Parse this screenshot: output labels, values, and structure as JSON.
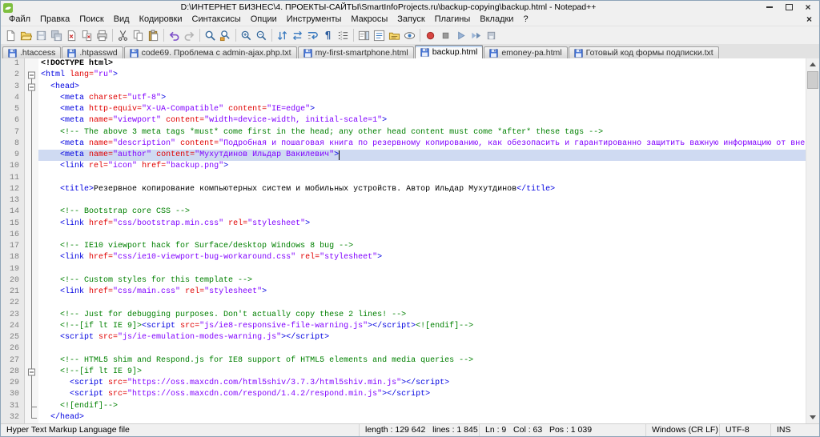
{
  "window": {
    "title": "D:\\ИНТЕРНЕТ БИЗНЕС\\4. ПРОЕКТЫ-САЙТЫ\\SmartInfoProjects.ru\\backup-copying\\backup.html - Notepad++",
    "icons": {
      "close": "×",
      "app": "notepad-plus-plus-logo"
    }
  },
  "menubar": {
    "items": [
      "Файл",
      "Правка",
      "Поиск",
      "Вид",
      "Кодировки",
      "Синтаксисы",
      "Опции",
      "Инструменты",
      "Макросы",
      "Запуск",
      "Плагины",
      "Вкладки",
      "?"
    ],
    "close_glyph": "×"
  },
  "toolbar": {
    "icons": [
      "new",
      "open",
      "save",
      "save-all",
      "close",
      "close-all",
      "print",
      "|",
      "cut",
      "copy",
      "paste",
      "|",
      "undo",
      "redo",
      "|",
      "find",
      "replace",
      "|",
      "zoom-in",
      "zoom-out",
      "|",
      "sync-v",
      "sync-h",
      "wrap",
      "show-all-chars",
      "indent-guide",
      "|",
      "doc-map",
      "function-list",
      "folder-workspace",
      "monitoring",
      "|",
      "record-macro",
      "stop-macro",
      "play-macro",
      "play-multi",
      "save-macro"
    ]
  },
  "tabs": [
    {
      "label": ".htaccess",
      "active": false
    },
    {
      "label": ".htpasswd",
      "active": false
    },
    {
      "label": "code69. Проблема с admin-ajax.php.txt",
      "active": false
    },
    {
      "label": "my-first-smartphone.html",
      "active": false
    },
    {
      "label": "backup.html",
      "active": true
    },
    {
      "label": "emoney-pa.html",
      "active": false
    },
    {
      "label": "Готовый код формы подписки.txt",
      "active": false
    }
  ],
  "editor": {
    "current_line": 9,
    "caret": {
      "line": 9,
      "col": 63
    },
    "lines": [
      {
        "f": "none",
        "s": [
          [
            "d",
            "<!DOCTYPE html>"
          ]
        ]
      },
      {
        "f": "start",
        "s": [
          [
            "t",
            "<html "
          ],
          [
            "a",
            "lang="
          ],
          [
            "v",
            "\"ru\""
          ],
          [
            "t",
            ">"
          ]
        ]
      },
      {
        "f": "start2",
        "s": [
          [
            "x",
            "  "
          ],
          [
            "t",
            "<head>"
          ]
        ]
      },
      {
        "f": "line",
        "s": [
          [
            "x",
            "    "
          ],
          [
            "t",
            "<meta "
          ],
          [
            "a",
            "charset="
          ],
          [
            "v",
            "\"utf-8\""
          ],
          [
            "t",
            ">"
          ]
        ]
      },
      {
        "f": "line",
        "s": [
          [
            "x",
            "    "
          ],
          [
            "t",
            "<meta "
          ],
          [
            "a",
            "http-equiv="
          ],
          [
            "v",
            "\"X-UA-Compatible\""
          ],
          [
            "x",
            " "
          ],
          [
            "a",
            "content="
          ],
          [
            "v",
            "\"IE=edge\""
          ],
          [
            "t",
            ">"
          ]
        ]
      },
      {
        "f": "line",
        "s": [
          [
            "x",
            "    "
          ],
          [
            "t",
            "<meta "
          ],
          [
            "a",
            "name="
          ],
          [
            "v",
            "\"viewport\""
          ],
          [
            "x",
            " "
          ],
          [
            "a",
            "content="
          ],
          [
            "v",
            "\"width=device-width, initial-scale=1\""
          ],
          [
            "t",
            ">"
          ]
        ]
      },
      {
        "f": "line",
        "s": [
          [
            "x",
            "    "
          ],
          [
            "c",
            "<!-- The above 3 meta tags *must* come first in the head; any other head content must come *after* these tags -->"
          ]
        ]
      },
      {
        "f": "line",
        "s": [
          [
            "x",
            "    "
          ],
          [
            "t",
            "<meta "
          ],
          [
            "a",
            "name="
          ],
          [
            "v",
            "\"description\""
          ],
          [
            "x",
            " "
          ],
          [
            "a",
            "content="
          ],
          [
            "v",
            "\"Подробная и пошаговая книга по резервному копированию, как обезопасить и гарантированно защитить важную информацию от внез"
          ]
        ]
      },
      {
        "f": "line",
        "s": [
          [
            "x",
            "    "
          ],
          [
            "t",
            "<meta "
          ],
          [
            "a",
            "name="
          ],
          [
            "v",
            "\"author\""
          ],
          [
            "x",
            " "
          ],
          [
            "a",
            "content="
          ],
          [
            "v",
            "\"Мухутдинов Ильдар Вакилевич\""
          ],
          [
            "t",
            ">"
          ]
        ]
      },
      {
        "f": "line",
        "s": [
          [
            "x",
            "    "
          ],
          [
            "t",
            "<link "
          ],
          [
            "a",
            "rel="
          ],
          [
            "v",
            "\"icon\""
          ],
          [
            "x",
            " "
          ],
          [
            "a",
            "href="
          ],
          [
            "v",
            "\"backup.png\""
          ],
          [
            "t",
            ">"
          ]
        ]
      },
      {
        "f": "line",
        "s": []
      },
      {
        "f": "line",
        "s": [
          [
            "x",
            "    "
          ],
          [
            "t",
            "<title>"
          ],
          [
            "x",
            "Резервное копирование компьютерных систем и мобильных устройств. Автор Ильдар Мухутдинов"
          ],
          [
            "t",
            "</title>"
          ]
        ]
      },
      {
        "f": "line",
        "s": []
      },
      {
        "f": "line",
        "s": [
          [
            "x",
            "    "
          ],
          [
            "c",
            "<!-- Bootstrap core CSS -->"
          ]
        ]
      },
      {
        "f": "line",
        "s": [
          [
            "x",
            "    "
          ],
          [
            "t",
            "<link "
          ],
          [
            "a",
            "href="
          ],
          [
            "v",
            "\"css/bootstrap.min.css\""
          ],
          [
            "x",
            " "
          ],
          [
            "a",
            "rel="
          ],
          [
            "v",
            "\"stylesheet\""
          ],
          [
            "t",
            ">"
          ]
        ]
      },
      {
        "f": "line",
        "s": []
      },
      {
        "f": "line",
        "s": [
          [
            "x",
            "    "
          ],
          [
            "c",
            "<!-- IE10 viewport hack for Surface/desktop Windows 8 bug -->"
          ]
        ]
      },
      {
        "f": "line",
        "s": [
          [
            "x",
            "    "
          ],
          [
            "t",
            "<link "
          ],
          [
            "a",
            "href="
          ],
          [
            "v",
            "\"css/ie10-viewport-bug-workaround.css\""
          ],
          [
            "x",
            " "
          ],
          [
            "a",
            "rel="
          ],
          [
            "v",
            "\"stylesheet\""
          ],
          [
            "t",
            ">"
          ]
        ]
      },
      {
        "f": "line",
        "s": []
      },
      {
        "f": "line",
        "s": [
          [
            "x",
            "    "
          ],
          [
            "c",
            "<!-- Custom styles for this template -->"
          ]
        ]
      },
      {
        "f": "line",
        "s": [
          [
            "x",
            "    "
          ],
          [
            "t",
            "<link "
          ],
          [
            "a",
            "href="
          ],
          [
            "v",
            "\"css/main.css\""
          ],
          [
            "x",
            " "
          ],
          [
            "a",
            "rel="
          ],
          [
            "v",
            "\"stylesheet\""
          ],
          [
            "t",
            ">"
          ]
        ]
      },
      {
        "f": "line",
        "s": []
      },
      {
        "f": "line",
        "s": [
          [
            "x",
            "    "
          ],
          [
            "c",
            "<!-- Just for debugging purposes. Don't actually copy these 2 lines! -->"
          ]
        ]
      },
      {
        "f": "line",
        "s": [
          [
            "x",
            "    "
          ],
          [
            "c",
            "<!--[if lt IE 9]>"
          ],
          [
            "t",
            "<script "
          ],
          [
            "a",
            "src="
          ],
          [
            "v",
            "\"js/ie8-responsive-file-warning.js\""
          ],
          [
            "t",
            "></script>"
          ],
          [
            "c",
            "<![endif]-->"
          ]
        ]
      },
      {
        "f": "line",
        "s": [
          [
            "x",
            "    "
          ],
          [
            "t",
            "<script "
          ],
          [
            "a",
            "src="
          ],
          [
            "v",
            "\"js/ie-emulation-modes-warning.js\""
          ],
          [
            "t",
            "></script>"
          ]
        ]
      },
      {
        "f": "line",
        "s": []
      },
      {
        "f": "line",
        "s": [
          [
            "x",
            "    "
          ],
          [
            "c",
            "<!-- HTML5 shim and Respond.js for IE8 support of HTML5 elements and media queries -->"
          ]
        ]
      },
      {
        "f": "start2",
        "s": [
          [
            "x",
            "    "
          ],
          [
            "c",
            "<!--[if lt IE 9]>"
          ]
        ]
      },
      {
        "f": "line",
        "s": [
          [
            "x",
            "      "
          ],
          [
            "t",
            "<script "
          ],
          [
            "a",
            "src="
          ],
          [
            "v",
            "\"https://oss.maxcdn.com/html5shiv/3.7.3/html5shiv.min.js\""
          ],
          [
            "t",
            "></script>"
          ]
        ]
      },
      {
        "f": "line",
        "s": [
          [
            "x",
            "      "
          ],
          [
            "t",
            "<script "
          ],
          [
            "a",
            "src="
          ],
          [
            "v",
            "\"https://oss.maxcdn.com/respond/1.4.2/respond.min.js\""
          ],
          [
            "t",
            "></script>"
          ]
        ]
      },
      {
        "f": "endc",
        "s": [
          [
            "x",
            "    "
          ],
          [
            "c",
            "<![endif]-->"
          ]
        ]
      },
      {
        "f": "end",
        "s": [
          [
            "x",
            "  "
          ],
          [
            "t",
            "</head>"
          ]
        ]
      }
    ]
  },
  "statusbar": {
    "doctype_label": "Hyper Text Markup Language file",
    "length_lines": "length : 129 642   lines : 1 845",
    "cursor": "Ln : 9   Col : 63   Pos : 1 039",
    "eol": "Windows (CR LF)",
    "encoding": "UTF-8",
    "mode": "INS"
  }
}
